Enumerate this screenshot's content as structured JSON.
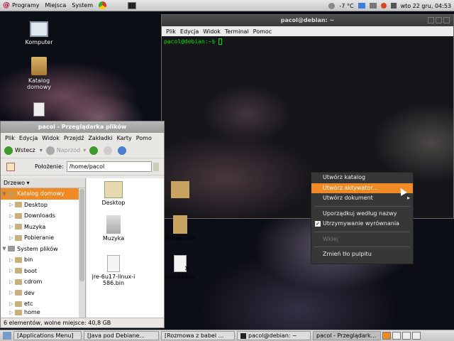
{
  "top_panel": {
    "menus": [
      "Programy",
      "Miejsca",
      "System"
    ],
    "temperature": "-7 °C",
    "datetime": "wto 22 gru, 04:53"
  },
  "desktop_icons": [
    {
      "label": "Komputer",
      "icon": "computer-icon"
    },
    {
      "label": "Katalog domowy",
      "icon": "home-folder-icon"
    },
    {
      "label": "",
      "icon": "trash-icon"
    }
  ],
  "file_manager": {
    "title": "pacol - Przeglądarka plików",
    "menu": [
      "Plik",
      "Edycja",
      "Widok",
      "Przejdź",
      "Zakładki",
      "Karty",
      "Pomo"
    ],
    "toolbar": {
      "back": "Wstecz",
      "forward": "Naprzód"
    },
    "location_label": "Położenie:",
    "location_value": "/home/pacol",
    "sidebar_header": "Drzewo",
    "tree": [
      {
        "label": "Katalog domowy",
        "level": 0,
        "selected": true
      },
      {
        "label": "Desktop",
        "level": 1
      },
      {
        "label": "Downloads",
        "level": 1
      },
      {
        "label": "Muzyka",
        "level": 1
      },
      {
        "label": "Pobieranie",
        "level": 1
      },
      {
        "label": "System plików",
        "level": 0
      },
      {
        "label": "bin",
        "level": 1
      },
      {
        "label": "boot",
        "level": 1
      },
      {
        "label": "cdrom",
        "level": 1
      },
      {
        "label": "dev",
        "level": 1
      },
      {
        "label": "etc",
        "level": 1
      },
      {
        "label": "home",
        "level": 1
      }
    ],
    "files": [
      {
        "label": "Desktop",
        "icon": "desktop-folder-icon"
      },
      {
        "label": "",
        "icon": "folder-icon"
      },
      {
        "label": "Muzyka",
        "icon": "music-folder-icon"
      },
      {
        "label": "Pobieranie",
        "icon": "download-folder-icon"
      },
      {
        "label": "jre-6u17-linux-i586.bin",
        "icon": "binary-file-icon"
      },
      {
        "label": "nano.save",
        "icon": "locked-file-icon"
      }
    ],
    "status": "6 elementów, wolne miejsce: 40,8 GB"
  },
  "terminal": {
    "title": "pacol@debian: ~",
    "menu": [
      "Plik",
      "Edycja",
      "Widok",
      "Terminal",
      "Pomoc"
    ],
    "prompt": "pacol@debian:~$"
  },
  "context_menu": {
    "items": [
      {
        "label": "Utwórz katalog"
      },
      {
        "label": "Utwórz aktywator...",
        "highlighted": true
      },
      {
        "label": "Utwórz dokument",
        "submenu": true
      },
      {
        "separator": true
      },
      {
        "label": "Uporządkuj według nazwy"
      },
      {
        "label": "Utrzymywanie wyrównania",
        "checked": true
      },
      {
        "separator": true
      },
      {
        "label": "Wklej",
        "disabled": true
      },
      {
        "separator": true
      },
      {
        "label": "Zmień tło pulpitu"
      }
    ]
  },
  "taskbar": {
    "tasks": [
      {
        "label": "[Applications Menu]"
      },
      {
        "label": "[Java pod Debiane..."
      },
      {
        "label": "[Rozmowa z babel ..."
      },
      {
        "label": "pacol@debian: ~"
      },
      {
        "label": "pacol - Przeglądark...",
        "active": true
      }
    ]
  },
  "colors": {
    "accent": "#f08a24",
    "terminal_text": "#00e000"
  }
}
